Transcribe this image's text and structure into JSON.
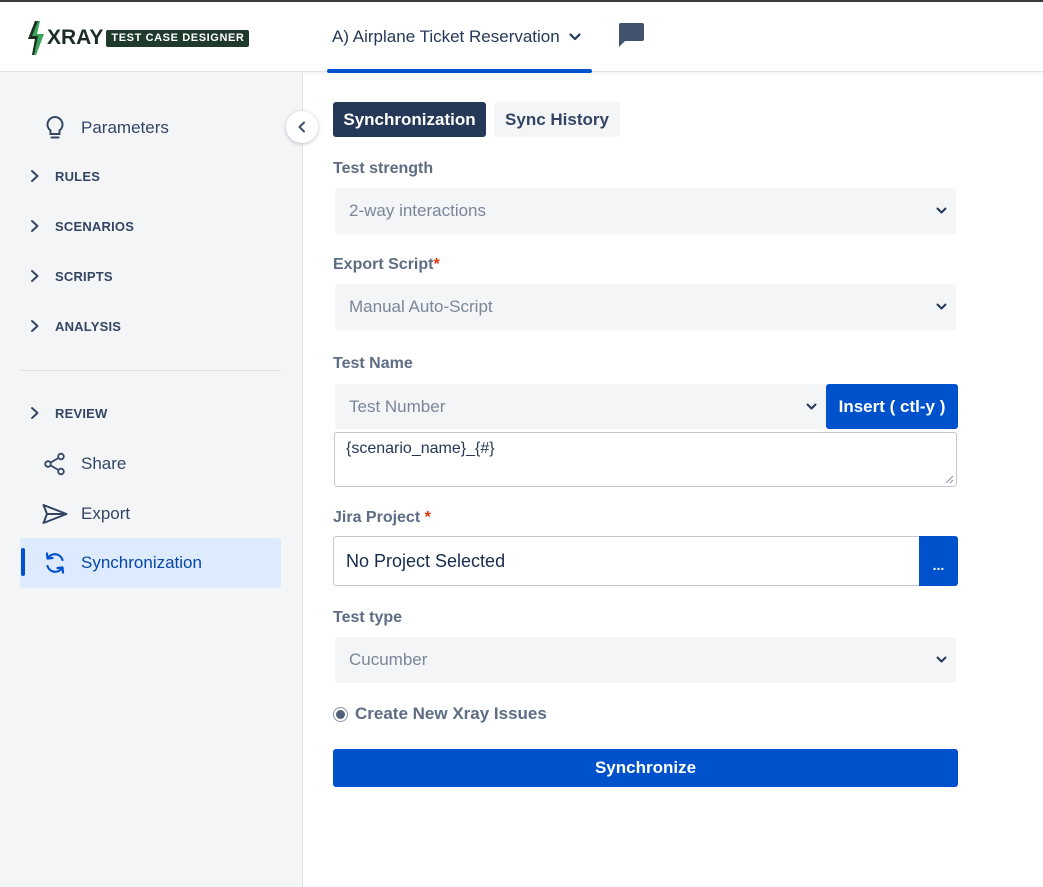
{
  "header": {
    "logo_text": "XRAY",
    "logo_badge": "TEST CASE DESIGNER",
    "project_name": "A) Airplane Ticket Reservation"
  },
  "sidebar": {
    "items": [
      {
        "label": "Parameters",
        "icon": "lightbulb-icon"
      },
      {
        "label": "RULES",
        "icon": "chevron-right-icon"
      },
      {
        "label": "SCENARIOS",
        "icon": "chevron-right-icon"
      },
      {
        "label": "SCRIPTS",
        "icon": "chevron-right-icon"
      },
      {
        "label": "ANALYSIS",
        "icon": "chevron-right-icon"
      },
      {
        "label": "REVIEW",
        "icon": "chevron-right-icon"
      },
      {
        "label": "Share",
        "icon": "share-icon"
      },
      {
        "label": "Export",
        "icon": "send-icon"
      },
      {
        "label": "Synchronization",
        "icon": "sync-icon",
        "active": true
      }
    ]
  },
  "tabs": [
    {
      "label": "Synchronization",
      "active": true
    },
    {
      "label": "Sync History",
      "active": false
    }
  ],
  "form": {
    "test_strength": {
      "label": "Test strength",
      "value": "2-way interactions"
    },
    "export_script": {
      "label": "Export Script",
      "required_mark": "*",
      "value": "Manual Auto-Script"
    },
    "test_name": {
      "label": "Test Name",
      "select_value": "Test Number",
      "insert_button": "Insert ( ctl-y )",
      "template": "{scenario_name}_{#}"
    },
    "jira_project": {
      "label": "Jira Project",
      "required_mark": "*",
      "value": "No Project Selected",
      "browse_button": "..."
    },
    "test_type": {
      "label": "Test type",
      "value": "Cucumber"
    },
    "create_issues": {
      "label": "Create New Xray Issues",
      "checked": true
    },
    "submit_label": "Synchronize"
  },
  "colors": {
    "primary": "#0052cc",
    "dark_tab": "#253858",
    "sidebar_bg": "#f4f5f7",
    "active_item_bg": "#deebff",
    "required": "#de350b"
  }
}
